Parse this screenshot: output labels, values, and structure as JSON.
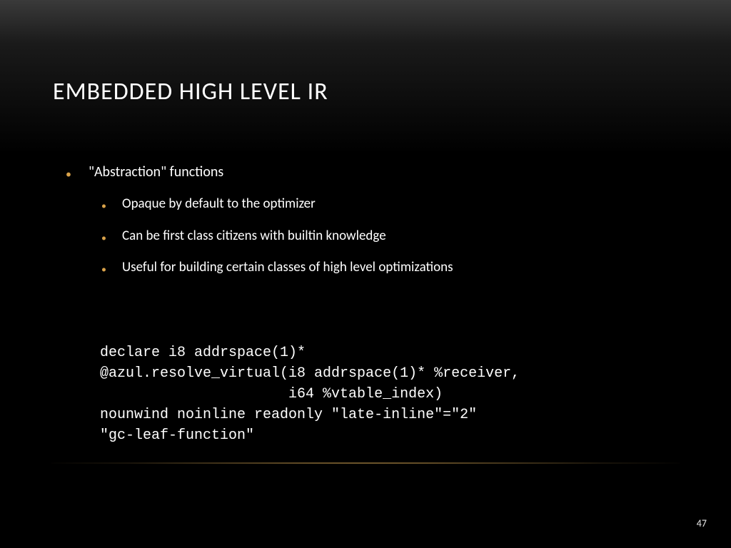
{
  "slide": {
    "title": "EMBEDDED HIGH LEVEL IR",
    "page_number": "47",
    "main_bullet": "\"Abstraction\" functions",
    "sub_bullets": [
      "Opaque by default to the optimizer",
      "Can be first class citizens with builtin knowledge",
      "Useful for building certain classes of high level optimizations"
    ],
    "code": "declare i8 addrspace(1)*\n@azul.resolve_virtual(i8 addrspace(1)* %receiver,\n                      i64 %vtable_index)\nnounwind noinline readonly \"late-inline\"=\"2\"\n\"gc-leaf-function\"",
    "colors": {
      "bullet_accent": "#d9a24a",
      "text": "#ffffff"
    }
  }
}
